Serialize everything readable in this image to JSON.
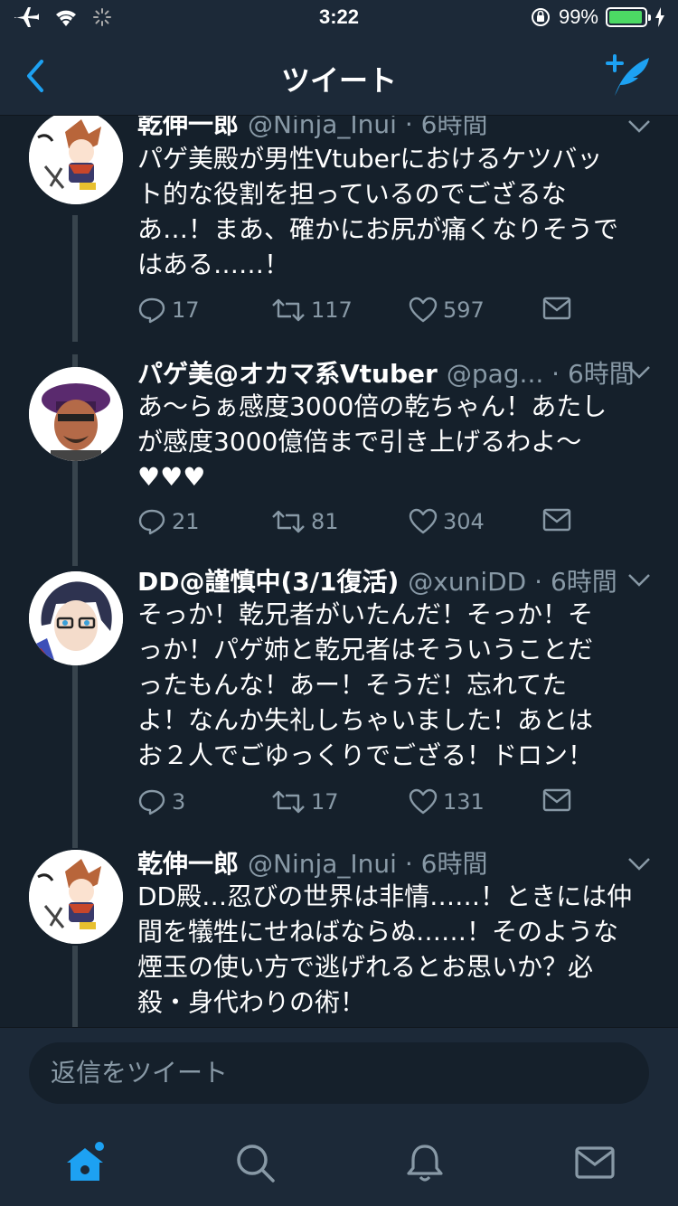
{
  "status": {
    "time": "3:22",
    "battery": "99%"
  },
  "nav": {
    "title": "ツイート"
  },
  "tweets": [
    {
      "name": "乾伸一郎",
      "handle": "@Ninja_Inui · 6時間",
      "lines": [
        "パゲ美殿が男性Vtuberにおけるケツバッ",
        "ト的な役割を担っているのでござるな",
        "あ…！まあ、確かにお尻が痛くなりそうで",
        "はある……！"
      ],
      "replies": "17",
      "retweets": "117",
      "likes": "597"
    },
    {
      "name": "パゲ美@オカマ系Vtuber",
      "handle": "@pag... · 6時間",
      "lines": [
        "あ〜らぁ感度3000倍の乾ちゃん！あたし",
        "が感度3000億倍まで引き上げるわよ〜",
        "♥♥♥"
      ],
      "replies": "21",
      "retweets": "81",
      "likes": "304"
    },
    {
      "name": "DD@謹慎中(3/1復活)",
      "handle": "@xuniDD · 6時間",
      "lines": [
        "そっか！乾兄者がいたんだ！そっか！そ",
        "っか！パゲ姉と乾兄者はそういうことだ",
        "ったもんな！あー！そうだ！忘れてた",
        "よ！なんか失礼しちゃいました！あとは",
        "お２人でごゆっくりでござる！ドロン！"
      ],
      "replies": "3",
      "retweets": "17",
      "likes": "131"
    },
    {
      "name": "乾伸一郎",
      "handle": "@Ninja_Inui · 6時間",
      "lines": [
        "DD殿…忍びの世界は非情……！ときには仲",
        "間を犠牲にせねばならぬ……！そのような",
        "煙玉の使い方で逃げれるとお思いか？必",
        "殺・身代わりの術！"
      ]
    }
  ],
  "reply": {
    "placeholder": "返信をツイート"
  },
  "colors": {
    "accent": "#1da1f2",
    "bg": "#15202b",
    "bar": "#1c2938",
    "muted": "#8899a6"
  }
}
